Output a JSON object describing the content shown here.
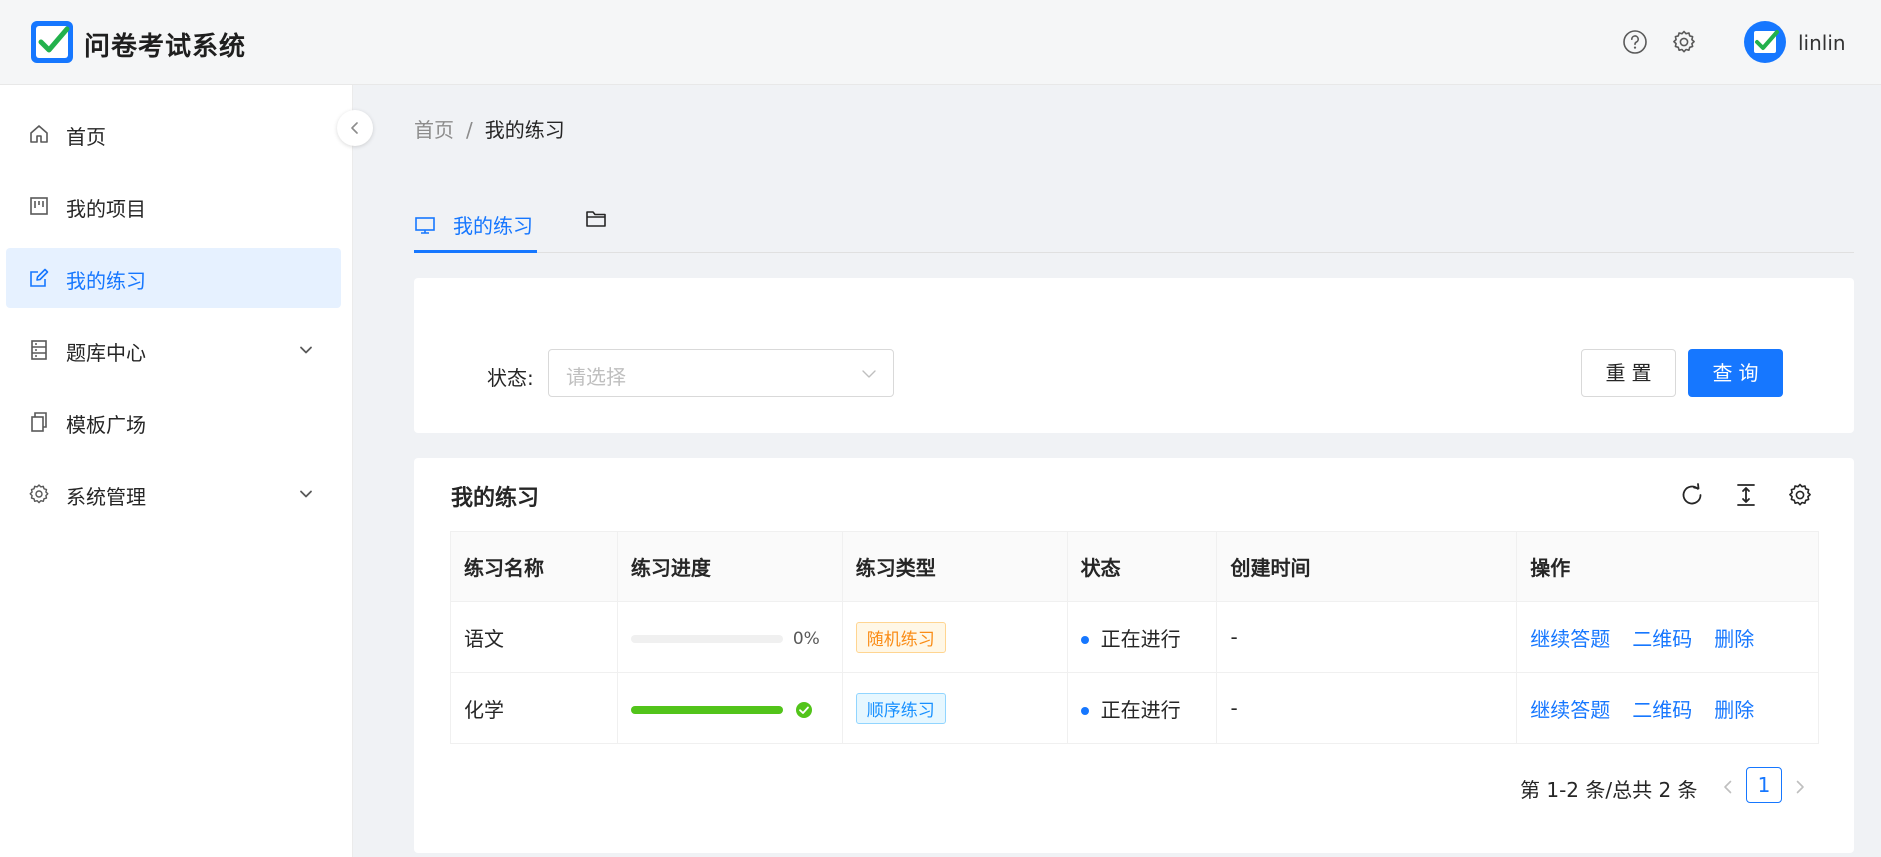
{
  "app": {
    "title": "问卷考试系统"
  },
  "header": {
    "username": "linlin"
  },
  "sidebar": {
    "items": [
      {
        "label": "首页",
        "icon": "home-icon"
      },
      {
        "label": "我的项目",
        "icon": "project-icon"
      },
      {
        "label": "我的练习",
        "icon": "edit-icon",
        "active": true
      },
      {
        "label": "题库中心",
        "icon": "database-icon",
        "expandable": true
      },
      {
        "label": "模板广场",
        "icon": "copy-icon"
      },
      {
        "label": "系统管理",
        "icon": "gear-icon",
        "expandable": true
      }
    ]
  },
  "breadcrumb": {
    "home": "首页",
    "separator": "/",
    "current": "我的练习"
  },
  "tabs": {
    "active_label": "我的练习"
  },
  "filter": {
    "status_label": "状态:",
    "status_placeholder": "请选择",
    "reset_label": "重置",
    "query_label": "查询"
  },
  "table": {
    "title": "我的练习",
    "columns": [
      "练习名称",
      "练习进度",
      "练习类型",
      "状态",
      "创建时间",
      "操作"
    ],
    "rows": [
      {
        "name": "语文",
        "progress": 0,
        "progress_text": "0%",
        "type": "随机练习",
        "status": "正在进行",
        "created": "-",
        "actions": [
          "继续答题",
          "二维码",
          "删除"
        ]
      },
      {
        "name": "化学",
        "progress": 100,
        "type": "顺序练习",
        "status": "正在进行",
        "created": "-",
        "actions": [
          "继续答题",
          "二维码",
          "删除"
        ]
      }
    ]
  },
  "pagination": {
    "total_text": "第 1-2 条/总共 2 条",
    "current_page": "1"
  },
  "colors": {
    "accent": "#1677ff",
    "success": "#52c41a",
    "active_bg": "#e6f1ff"
  }
}
